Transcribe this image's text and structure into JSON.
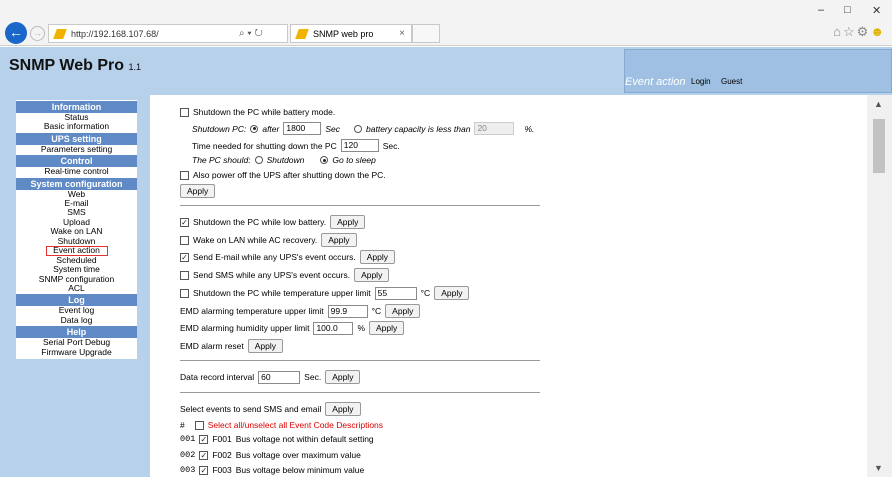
{
  "browser": {
    "url": "http://192.168.107.68/",
    "address_controls": "⌕ ▾ ↻",
    "tab_title": "SNMP web pro",
    "win_min": "–",
    "win_restore": "□",
    "win_close": "✕",
    "back_icon": "←",
    "forward_icon": "→",
    "tab_close_icon": "×",
    "toolbar_icons": "⌂☆⚙"
  },
  "header": {
    "title": "SNMP Web Pro",
    "version": "1.1",
    "page": "Event action",
    "login": "Login",
    "guest": "Guest"
  },
  "sidebar": {
    "information": {
      "title": "Information",
      "items": [
        "Status",
        "Basic information"
      ]
    },
    "ups_setting": {
      "title": "UPS setting",
      "items": [
        "Parameters setting"
      ]
    },
    "control": {
      "title": "Control",
      "items": [
        "Real-time control"
      ]
    },
    "system_configuration": {
      "title": "System configuration",
      "items": [
        "Web",
        "E-mail",
        "SMS",
        "Upload",
        "Wake on LAN",
        "Shutdown",
        "Event action",
        "Scheduled",
        "System time",
        "SNMP configuration",
        "ACL"
      ]
    },
    "log": {
      "title": "Log",
      "items": [
        "Event log",
        "Data log"
      ]
    },
    "help": {
      "title": "Help",
      "items": [
        "Serial Port Debug",
        "Firmware Upgrade"
      ]
    }
  },
  "battery": {
    "label": "Shutdown the PC while battery mode.",
    "shutdown_pc": "Shutdown PC:",
    "after": "after",
    "after_value": "1800",
    "sec": "Sec",
    "capacity": "battery capacity is less than",
    "capacity_value": "20",
    "percent": "%.",
    "time_needed": "Time needed for shutting down the PC",
    "time_value": "120",
    "time_unit": "Sec.",
    "pc_should": "The PC should:",
    "shutdown": "Shutdown",
    "sleep": "Go to sleep",
    "power_off": "Also power off the UPS after shutting down the PC.",
    "apply": "Apply"
  },
  "events": {
    "low_battery": "Shutdown the PC while low battery.",
    "wake_lan": "Wake on LAN while AC recovery.",
    "email": "Send E-mail while any UPS's event occurs.",
    "sms": "Send SMS while any UPS's event occurs.",
    "temp_limit": "Shutdown the PC while temperature upper limit",
    "temp_value": "55",
    "temp_unit": "°C",
    "emd_temp": "EMD alarming temperature upper limit",
    "emd_temp_value": "99.9",
    "emd_temp_unit": "°C",
    "emd_hum": "EMD alarming humidity upper limit",
    "emd_hum_value": "100.0",
    "emd_hum_unit": "%",
    "emd_reset": "EMD alarm reset",
    "apply": "Apply"
  },
  "data_record": {
    "label": "Data record interval",
    "value": "60",
    "unit": "Sec.",
    "apply": "Apply"
  },
  "select_events": {
    "label": "Select events to send SMS and email",
    "apply": "Apply",
    "hash": "#",
    "select_all": "Select all/unselect all Event Code Descriptions",
    "rows": [
      {
        "num": "001",
        "code": "F001",
        "desc": "Bus voltage not within default setting"
      },
      {
        "num": "002",
        "code": "F002",
        "desc": "Bus voltage over maximum value"
      },
      {
        "num": "003",
        "code": "F003",
        "desc": "Bus voltage below minimum value"
      }
    ]
  },
  "scrollbar": {
    "up": "▲",
    "down": "▼"
  }
}
